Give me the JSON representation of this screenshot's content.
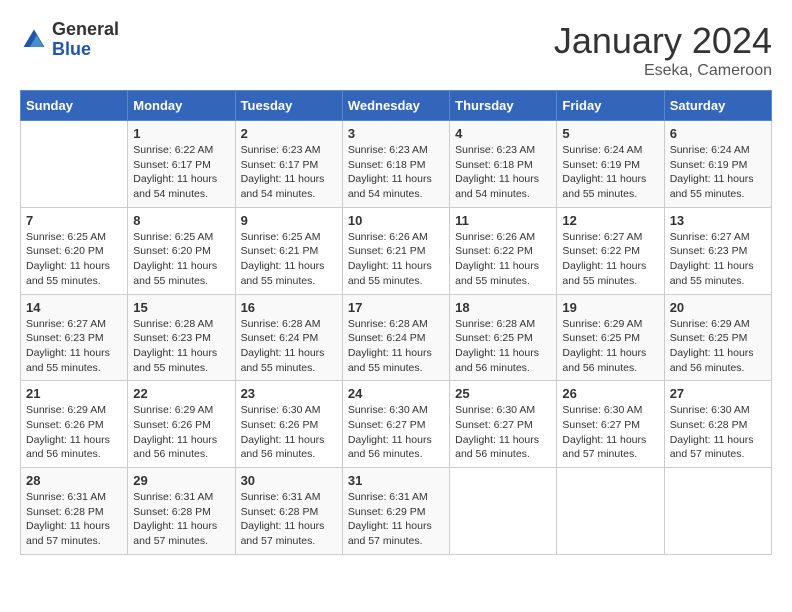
{
  "header": {
    "logo_general": "General",
    "logo_blue": "Blue",
    "month_title": "January 2024",
    "subtitle": "Eseka, Cameroon"
  },
  "days_of_week": [
    "Sunday",
    "Monday",
    "Tuesday",
    "Wednesday",
    "Thursday",
    "Friday",
    "Saturday"
  ],
  "weeks": [
    [
      {
        "day": "",
        "info": ""
      },
      {
        "day": "1",
        "info": "Sunrise: 6:22 AM\nSunset: 6:17 PM\nDaylight: 11 hours and 54 minutes."
      },
      {
        "day": "2",
        "info": "Sunrise: 6:23 AM\nSunset: 6:17 PM\nDaylight: 11 hours and 54 minutes."
      },
      {
        "day": "3",
        "info": "Sunrise: 6:23 AM\nSunset: 6:18 PM\nDaylight: 11 hours and 54 minutes."
      },
      {
        "day": "4",
        "info": "Sunrise: 6:23 AM\nSunset: 6:18 PM\nDaylight: 11 hours and 54 minutes."
      },
      {
        "day": "5",
        "info": "Sunrise: 6:24 AM\nSunset: 6:19 PM\nDaylight: 11 hours and 55 minutes."
      },
      {
        "day": "6",
        "info": "Sunrise: 6:24 AM\nSunset: 6:19 PM\nDaylight: 11 hours and 55 minutes."
      }
    ],
    [
      {
        "day": "7",
        "info": "Sunrise: 6:25 AM\nSunset: 6:20 PM\nDaylight: 11 hours and 55 minutes."
      },
      {
        "day": "8",
        "info": "Sunrise: 6:25 AM\nSunset: 6:20 PM\nDaylight: 11 hours and 55 minutes."
      },
      {
        "day": "9",
        "info": "Sunrise: 6:25 AM\nSunset: 6:21 PM\nDaylight: 11 hours and 55 minutes."
      },
      {
        "day": "10",
        "info": "Sunrise: 6:26 AM\nSunset: 6:21 PM\nDaylight: 11 hours and 55 minutes."
      },
      {
        "day": "11",
        "info": "Sunrise: 6:26 AM\nSunset: 6:22 PM\nDaylight: 11 hours and 55 minutes."
      },
      {
        "day": "12",
        "info": "Sunrise: 6:27 AM\nSunset: 6:22 PM\nDaylight: 11 hours and 55 minutes."
      },
      {
        "day": "13",
        "info": "Sunrise: 6:27 AM\nSunset: 6:23 PM\nDaylight: 11 hours and 55 minutes."
      }
    ],
    [
      {
        "day": "14",
        "info": "Sunrise: 6:27 AM\nSunset: 6:23 PM\nDaylight: 11 hours and 55 minutes."
      },
      {
        "day": "15",
        "info": "Sunrise: 6:28 AM\nSunset: 6:23 PM\nDaylight: 11 hours and 55 minutes."
      },
      {
        "day": "16",
        "info": "Sunrise: 6:28 AM\nSunset: 6:24 PM\nDaylight: 11 hours and 55 minutes."
      },
      {
        "day": "17",
        "info": "Sunrise: 6:28 AM\nSunset: 6:24 PM\nDaylight: 11 hours and 55 minutes."
      },
      {
        "day": "18",
        "info": "Sunrise: 6:28 AM\nSunset: 6:25 PM\nDaylight: 11 hours and 56 minutes."
      },
      {
        "day": "19",
        "info": "Sunrise: 6:29 AM\nSunset: 6:25 PM\nDaylight: 11 hours and 56 minutes."
      },
      {
        "day": "20",
        "info": "Sunrise: 6:29 AM\nSunset: 6:25 PM\nDaylight: 11 hours and 56 minutes."
      }
    ],
    [
      {
        "day": "21",
        "info": "Sunrise: 6:29 AM\nSunset: 6:26 PM\nDaylight: 11 hours and 56 minutes."
      },
      {
        "day": "22",
        "info": "Sunrise: 6:29 AM\nSunset: 6:26 PM\nDaylight: 11 hours and 56 minutes."
      },
      {
        "day": "23",
        "info": "Sunrise: 6:30 AM\nSunset: 6:26 PM\nDaylight: 11 hours and 56 minutes."
      },
      {
        "day": "24",
        "info": "Sunrise: 6:30 AM\nSunset: 6:27 PM\nDaylight: 11 hours and 56 minutes."
      },
      {
        "day": "25",
        "info": "Sunrise: 6:30 AM\nSunset: 6:27 PM\nDaylight: 11 hours and 56 minutes."
      },
      {
        "day": "26",
        "info": "Sunrise: 6:30 AM\nSunset: 6:27 PM\nDaylight: 11 hours and 57 minutes."
      },
      {
        "day": "27",
        "info": "Sunrise: 6:30 AM\nSunset: 6:28 PM\nDaylight: 11 hours and 57 minutes."
      }
    ],
    [
      {
        "day": "28",
        "info": "Sunrise: 6:31 AM\nSunset: 6:28 PM\nDaylight: 11 hours and 57 minutes."
      },
      {
        "day": "29",
        "info": "Sunrise: 6:31 AM\nSunset: 6:28 PM\nDaylight: 11 hours and 57 minutes."
      },
      {
        "day": "30",
        "info": "Sunrise: 6:31 AM\nSunset: 6:28 PM\nDaylight: 11 hours and 57 minutes."
      },
      {
        "day": "31",
        "info": "Sunrise: 6:31 AM\nSunset: 6:29 PM\nDaylight: 11 hours and 57 minutes."
      },
      {
        "day": "",
        "info": ""
      },
      {
        "day": "",
        "info": ""
      },
      {
        "day": "",
        "info": ""
      }
    ]
  ]
}
